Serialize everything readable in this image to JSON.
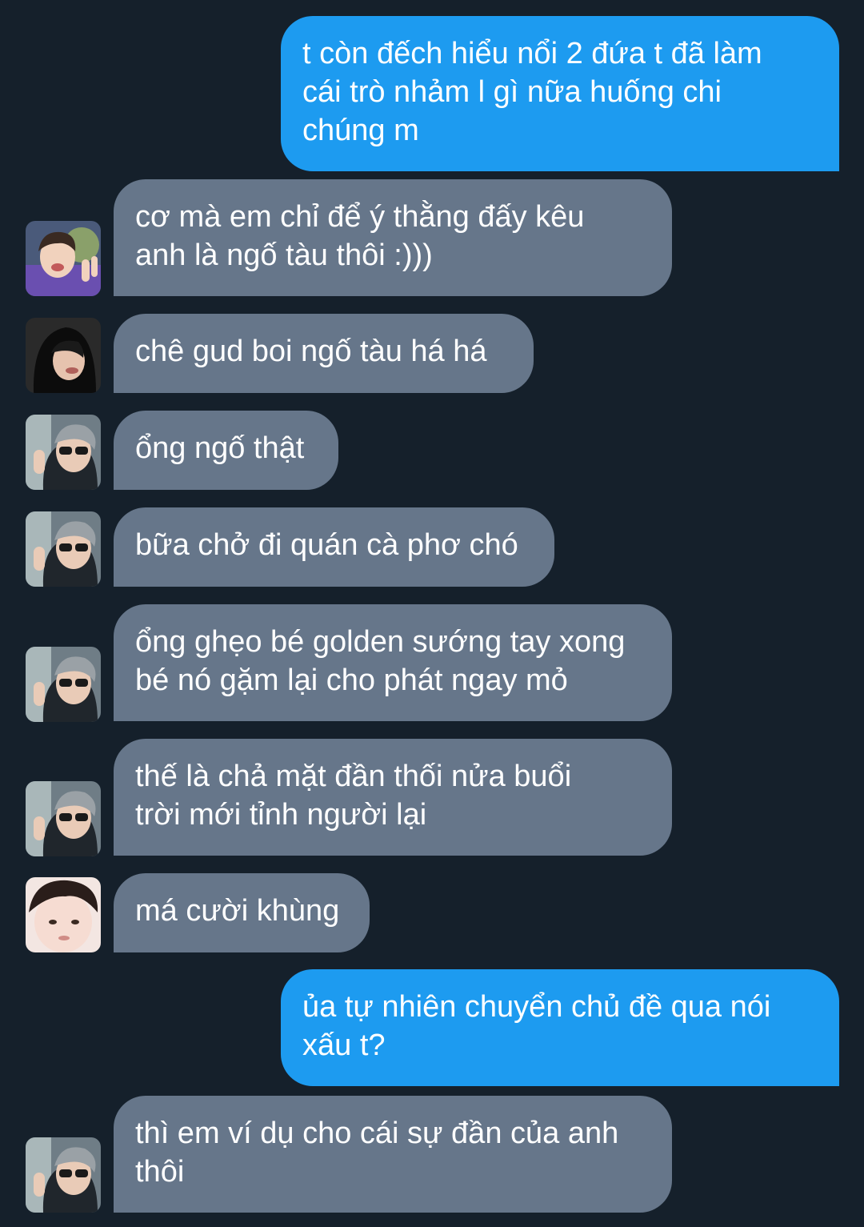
{
  "messages": [
    {
      "side": "out",
      "text": "t còn đếch hiểu nổi 2 đứa t đã làm\ncái trò nhảm l gì nữa huống chi\nchúng m"
    },
    {
      "side": "in",
      "avatar": "avatar-boy-peace-sign",
      "text": "cơ mà em chỉ để ý thằng đấy kêu\nanh là ngố tàu thôi :)))"
    },
    {
      "side": "in",
      "avatar": "avatar-boy-black-hoodie",
      "text": "chê gud boi ngố tàu há há"
    },
    {
      "side": "in",
      "avatar": "avatar-boy-sunglasses",
      "text": "ổng ngố thật"
    },
    {
      "side": "in",
      "avatar": "avatar-boy-sunglasses",
      "text": "bữa chở đi quán cà phơ chó"
    },
    {
      "side": "in",
      "avatar": "avatar-boy-sunglasses",
      "text": "ổng ghẹo bé golden sướng tay xong\nbé nó gặm lại cho phát ngay mỏ"
    },
    {
      "side": "in",
      "avatar": "avatar-boy-sunglasses",
      "text": "thế là chả mặt đần thối nửa buổi\ntrời mới tỉnh người lại"
    },
    {
      "side": "in",
      "avatar": "avatar-boy-close-up",
      "text": "má cười khùng"
    },
    {
      "side": "out",
      "text": "ủa tự nhiên chuyển chủ đề qua nói\nxấu t?"
    },
    {
      "side": "in",
      "avatar": "avatar-boy-sunglasses",
      "text": "thì em ví dụ cho cái sự đần của anh\nthôi"
    }
  ],
  "colors": {
    "background": "#15202b",
    "outgoing_bubble": "#1d9bf0",
    "incoming_bubble": "#66768a",
    "text": "#ffffff"
  }
}
